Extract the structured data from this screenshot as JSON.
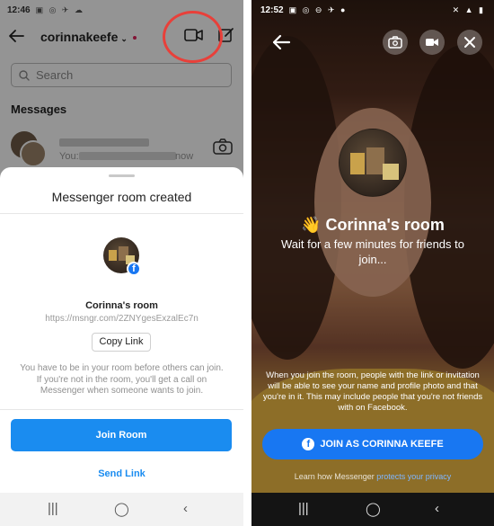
{
  "left": {
    "status": {
      "time": "12:46",
      "left_icons": "▣ ◎ ✈ ☁",
      "right_icons": "✕ ▲ ▮"
    },
    "header": {
      "username": "corinnakeefe",
      "chevron": "⌄"
    },
    "search": {
      "placeholder": "Search"
    },
    "messages_heading": "Messages",
    "conversation": {
      "sub_prefix": "You:",
      "time": "now"
    },
    "sheet": {
      "title": "Messenger room created",
      "room_name": "Corinna's room",
      "room_link": "https://msngr.com/2ZNYgesExzalEc7n",
      "copy_label": "Copy Link",
      "note": "You have to be in your room before others can join. If you're not in the room, you'll get a call on Messenger when someone wants to join.",
      "join_label": "Join Room",
      "send_label": "Send Link",
      "fb_letter": "f"
    },
    "nav": {
      "recent": "|||",
      "home": "◯",
      "back": "‹"
    }
  },
  "right": {
    "status": {
      "time": "12:52",
      "left_icons": "▣ ◎ ⊖ ✈ ●",
      "right_icons": "✕ ▲ ▮"
    },
    "room_title": "👋 Corinna's room",
    "room_sub": "Wait for a few minutes for friends to join...",
    "disclaimer": "When you join the room, people with the link or invitation will be able to see your name and profile photo and that you're in it. This may include people that you're not friends with on Facebook.",
    "join_label": "JOIN AS CORINNA KEEFE",
    "fb_letter": "f",
    "privacy_prefix": "Learn how Messenger ",
    "privacy_link": "protects your privacy",
    "nav": {
      "recent": "|||",
      "home": "◯",
      "back": "‹"
    }
  },
  "colors": {
    "accent": "#1a8cf0",
    "facebook": "#1877f2",
    "highlight_ring": "#e8403a"
  },
  "icons": [
    "back-arrow-icon",
    "video-camera-icon",
    "compose-icon",
    "search-icon",
    "camera-icon",
    "facebook-icon",
    "flip-camera-icon",
    "close-icon"
  ]
}
